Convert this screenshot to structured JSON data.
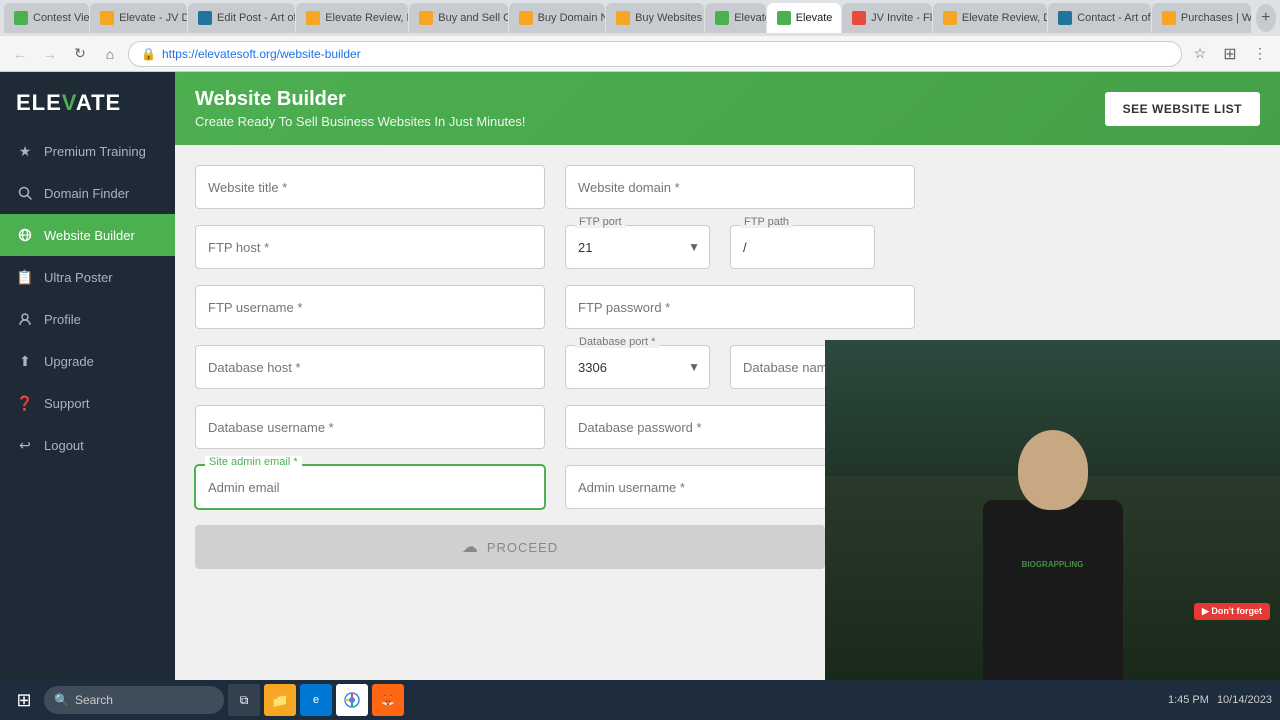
{
  "browser": {
    "url": "https://elevatesoft.org/website-builder",
    "tabs": [
      {
        "label": "Contest View |",
        "active": false,
        "favicon_color": "#4CAF50"
      },
      {
        "label": "Elevate - JV DOC",
        "active": false,
        "favicon_color": "#f5a623"
      },
      {
        "label": "Edit Post - Art of M...",
        "active": false,
        "favicon_color": "#21759b"
      },
      {
        "label": "Elevate Review, Der...",
        "active": false,
        "favicon_color": "#f5a623"
      },
      {
        "label": "Buy and Sell On...",
        "active": false,
        "favicon_color": "#f5a623"
      },
      {
        "label": "Buy Domain Na...",
        "active": false,
        "favicon_color": "#f5a623"
      },
      {
        "label": "Buy Websites fo...",
        "active": false,
        "favicon_color": "#f5a623"
      },
      {
        "label": "Elevate",
        "active": false,
        "favicon_color": "#4CAF50"
      },
      {
        "label": "Elevate",
        "active": true,
        "favicon_color": "#4CAF50"
      },
      {
        "label": "JV Invite - Flare",
        "active": false,
        "favicon_color": "#e74c3c"
      },
      {
        "label": "Elevate Review, Den...",
        "active": false,
        "favicon_color": "#f5a623"
      },
      {
        "label": "Contact - Art of M...",
        "active": false,
        "favicon_color": "#21759b"
      },
      {
        "label": "Purchases | War...",
        "active": false,
        "favicon_color": "#f5a623"
      }
    ]
  },
  "sidebar": {
    "logo": "ELEVATE",
    "items": [
      {
        "id": "premium-training",
        "label": "Premium Training",
        "icon": "★"
      },
      {
        "id": "domain-finder",
        "label": "Domain Finder",
        "icon": "🔍"
      },
      {
        "id": "website-builder",
        "label": "Website Builder",
        "icon": "🌐"
      },
      {
        "id": "ultra-poster",
        "label": "Ultra Poster",
        "icon": "📋"
      },
      {
        "id": "profile",
        "label": "Profile",
        "icon": "👤"
      },
      {
        "id": "upgrade",
        "label": "Upgrade",
        "icon": "⬆"
      },
      {
        "id": "support",
        "label": "Support",
        "icon": "❓"
      },
      {
        "id": "logout",
        "label": "Logout",
        "icon": "↩"
      }
    ]
  },
  "header": {
    "title": "Website Builder",
    "subtitle": "Create Ready To Sell Business Websites In Just Minutes!",
    "cta_button": "SEE WEBSITE LIST"
  },
  "form": {
    "fields": {
      "website_title": {
        "label": "Website title *",
        "placeholder": "Website title *",
        "value": ""
      },
      "website_domain": {
        "label": "Website domain *",
        "placeholder": "Website domain *",
        "value": ""
      },
      "ftp_host": {
        "label": "FTP host *",
        "placeholder": "FTP host *",
        "value": ""
      },
      "ftp_port": {
        "label": "FTP port",
        "placeholder": "FTP port",
        "value": "21"
      },
      "ftp_path": {
        "label": "FTP path",
        "placeholder": "FTP path",
        "value": "/"
      },
      "ftp_username": {
        "label": "FTP username *",
        "placeholder": "FTP username *",
        "value": ""
      },
      "ftp_password": {
        "label": "FTP password *",
        "placeholder": "FTP password *",
        "value": ""
      },
      "database_host": {
        "label": "Database host *",
        "placeholder": "Database host *",
        "value": ""
      },
      "database_port": {
        "label": "Database port *",
        "placeholder": "Database port *",
        "value": "3306"
      },
      "database_name": {
        "label": "Database name *",
        "placeholder": "Database name *",
        "value": ""
      },
      "database_username": {
        "label": "Database username *",
        "placeholder": "Database username *",
        "value": ""
      },
      "database_password": {
        "label": "Database password *",
        "placeholder": "Database password *",
        "value": ""
      },
      "site_admin_email": {
        "label": "Site admin email *",
        "placeholder": "Admin email",
        "value": ""
      },
      "admin_username": {
        "label": "Admin username *",
        "placeholder": "Admin username *",
        "value": ""
      }
    },
    "proceed_button": "PROCEED"
  },
  "taskbar": {
    "search_placeholder": "Search",
    "time": "1:45 PM",
    "date": "10/14/2023"
  }
}
